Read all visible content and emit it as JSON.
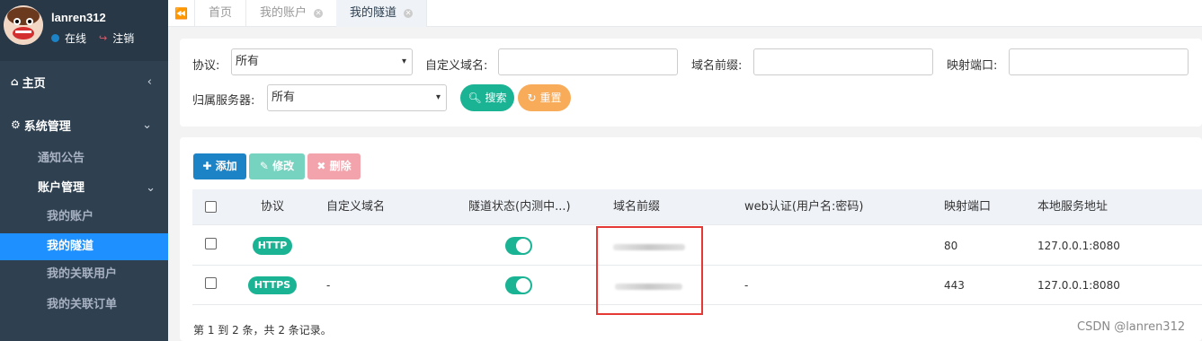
{
  "user": {
    "name": "lanren312",
    "status": "在线",
    "logout": "注销"
  },
  "sidebar": {
    "home": "主页",
    "system": "系统管理",
    "items": [
      {
        "label": "通知公告"
      },
      {
        "label": "账户管理"
      },
      {
        "label": "我的账户"
      },
      {
        "label": "我的隧道"
      },
      {
        "label": "我的关联用户"
      },
      {
        "label": "我的关联订单"
      }
    ]
  },
  "tabs": [
    {
      "label": "首页"
    },
    {
      "label": "我的账户"
    },
    {
      "label": "我的隧道"
    }
  ],
  "search": {
    "protocol_label": "协议:",
    "protocol_value": "所有",
    "custom_domain_label": "自定义域名:",
    "prefix_label": "域名前缀:",
    "port_label": "映射端口:",
    "server_label": "归属服务器:",
    "server_value": "所有",
    "search_btn": "搜索",
    "reset_btn": "重置"
  },
  "toolbar": {
    "add": "添加",
    "edit": "修改",
    "delete": "删除"
  },
  "table": {
    "headers": [
      "协议",
      "自定义域名",
      "隧道状态(内测中...)",
      "域名前缀",
      "web认证(用户名:密码)",
      "映射端口",
      "本地服务地址"
    ],
    "rows": [
      {
        "protocol": "HTTP",
        "custom_domain": "",
        "web_auth": "",
        "port": "80",
        "local": "127.0.0.1:8080"
      },
      {
        "protocol": "HTTPS",
        "custom_domain": "-",
        "web_auth": "-",
        "port": "443",
        "local": "127.0.0.1:8080"
      }
    ]
  },
  "footer": "第 1 到 2 条，共 2 条记录。",
  "watermark": "CSDN @lanren312",
  "colors": {
    "sidebar": "#2f4050",
    "active": "#1e90ff",
    "primary": "#1ab394",
    "warning": "#f8ac59",
    "danger": "#ed5565",
    "blue": "#1c84c6"
  }
}
